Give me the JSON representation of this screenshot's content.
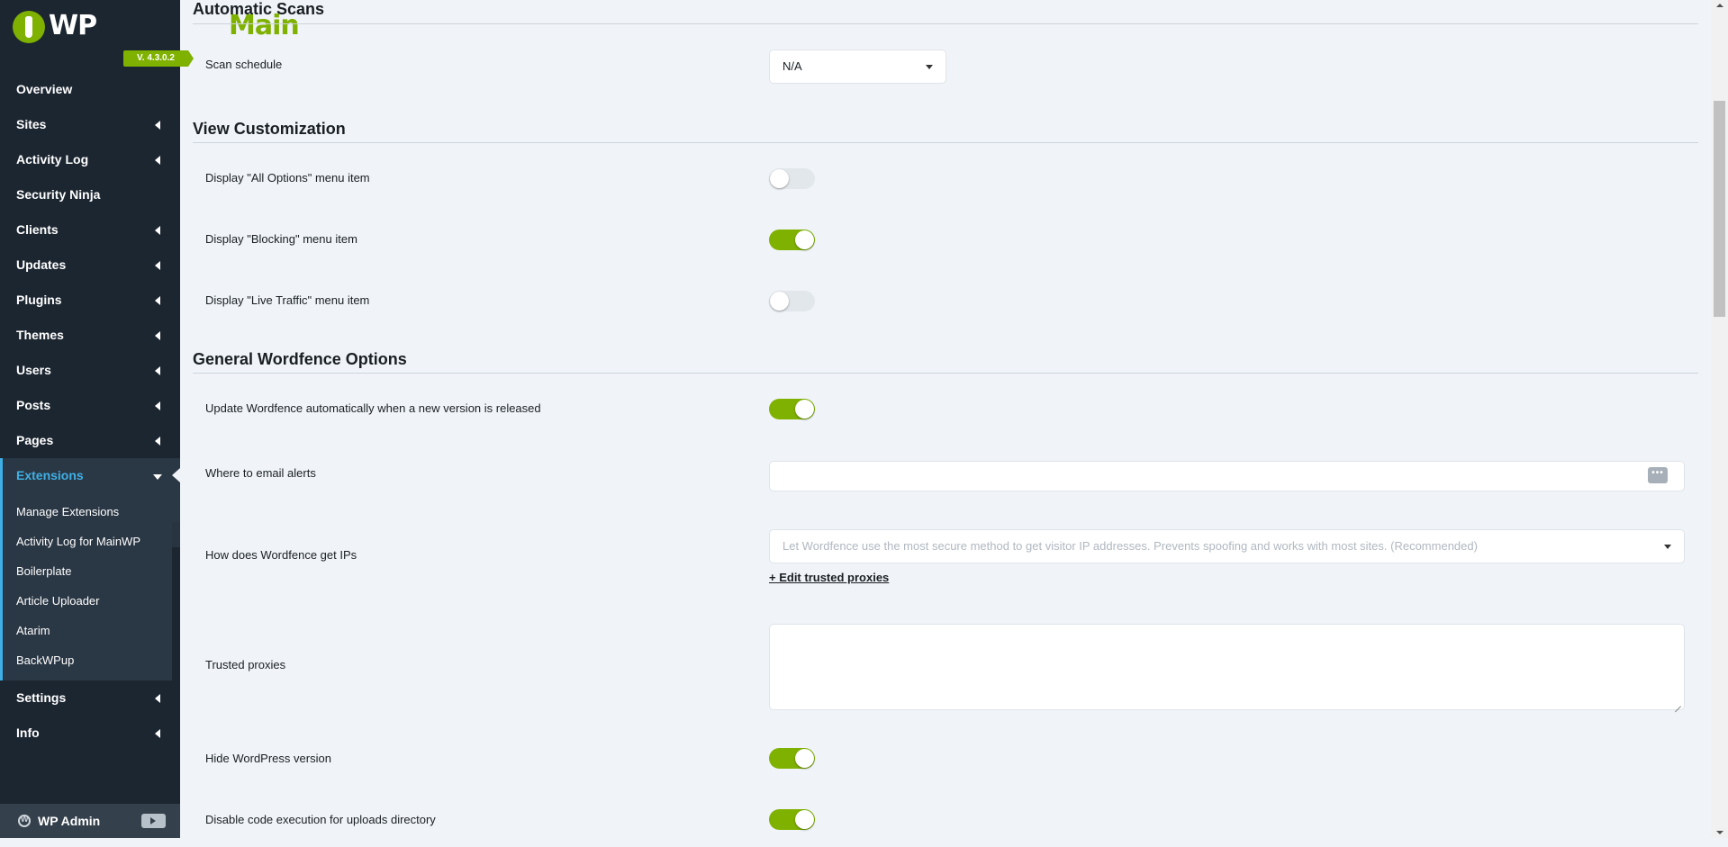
{
  "app": {
    "logo_main": "Main",
    "logo_wp": "WP",
    "version": "V. 4.3.0.2"
  },
  "sidebar": {
    "items": [
      {
        "label": "Overview",
        "has_arrow": false
      },
      {
        "label": "Sites",
        "has_arrow": true
      },
      {
        "label": "Activity Log",
        "has_arrow": true
      },
      {
        "label": "Security Ninja",
        "has_arrow": false
      },
      {
        "label": "Clients",
        "has_arrow": true
      },
      {
        "label": "Updates",
        "has_arrow": true
      },
      {
        "label": "Plugins",
        "has_arrow": true
      },
      {
        "label": "Themes",
        "has_arrow": true
      },
      {
        "label": "Users",
        "has_arrow": true
      },
      {
        "label": "Posts",
        "has_arrow": true
      },
      {
        "label": "Pages",
        "has_arrow": true
      },
      {
        "label": "Extensions",
        "active": true
      }
    ],
    "submenu": [
      "Manage Extensions",
      "Activity Log for MainWP",
      "Boilerplate",
      "Article Uploader",
      "Atarim",
      "BackWPup"
    ],
    "items_after": [
      {
        "label": "Settings",
        "has_arrow": true
      },
      {
        "label": "Info",
        "has_arrow": true
      }
    ],
    "footer": {
      "wp_admin": "WP Admin"
    }
  },
  "sections": {
    "automatic_scans": {
      "title": "Automatic Scans",
      "scan_schedule_label": "Scan schedule",
      "scan_schedule_value": "N/A"
    },
    "view_customization": {
      "title": "View Customization",
      "all_options_label": "Display \"All Options\" menu item",
      "all_options_on": false,
      "blocking_label": "Display \"Blocking\" menu item",
      "blocking_on": true,
      "live_traffic_label": "Display \"Live Traffic\" menu item",
      "live_traffic_on": false
    },
    "general_options": {
      "title": "General Wordfence Options",
      "auto_update_label": "Update Wordfence automatically when a new version is released",
      "auto_update_on": true,
      "email_alerts_label": "Where to email alerts",
      "email_alerts_value": "",
      "ip_method_label": "How does Wordfence get IPs",
      "ip_method_placeholder": "Let Wordfence use the most secure method to get visitor IP addresses. Prevents spoofing and works with most sites. (Recommended)",
      "edit_proxies_link": "+ Edit trusted proxies",
      "trusted_proxies_label": "Trusted proxies",
      "trusted_proxies_value": "",
      "hide_wp_version_label": "Hide WordPress version",
      "hide_wp_version_on": true,
      "disable_code_exec_label": "Disable code execution for uploads directory",
      "disable_code_exec_on": true
    }
  },
  "colors": {
    "accent_green": "#7fb100",
    "accent_blue": "#3fb0e6",
    "sidebar_bg": "#1c2631",
    "content_bg": "#f0f4f8"
  },
  "icons": {
    "dots": "more-dots-icon",
    "wp": "wordpress-icon",
    "logout": "logout-icon"
  }
}
